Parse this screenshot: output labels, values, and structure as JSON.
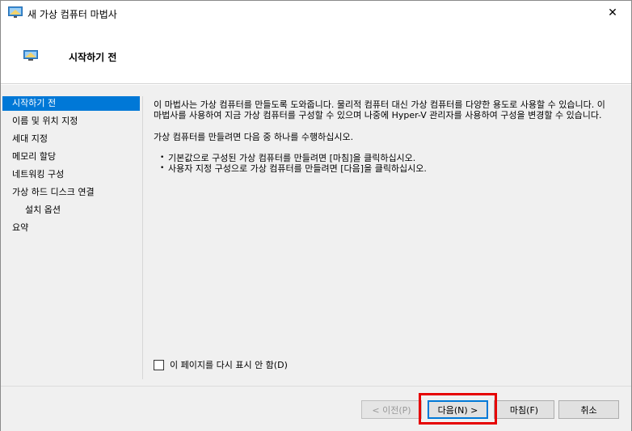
{
  "window": {
    "title": "새 가상 컴퓨터 마법사",
    "close_glyph": "✕",
    "icon": "vm-monitor-icon"
  },
  "header": {
    "title": "시작하기 전"
  },
  "sidebar": {
    "items": [
      {
        "label": "시작하기 전",
        "active": true
      },
      {
        "label": "이름 및 위치 지정",
        "active": false
      },
      {
        "label": "세대 지정",
        "active": false
      },
      {
        "label": "메모리 할당",
        "active": false
      },
      {
        "label": "네트워킹 구성",
        "active": false
      },
      {
        "label": "가상 하드 디스크 연결",
        "active": false
      },
      {
        "label": "설치 옵션",
        "active": false,
        "sub": true
      },
      {
        "label": "요약",
        "active": false
      }
    ]
  },
  "main": {
    "intro": "이 마법사는 가상 컴퓨터를 만들도록 도와줍니다. 물리적 컴퓨터 대신 가상 컴퓨터를 다양한 용도로 사용할 수 있습니다. 이 마법사를 사용하여 지금 가상 컴퓨터를 구성할 수 있으며 나중에 Hyper-V 관리자를 사용하여 구성을 변경할 수 있습니다.",
    "instruction": "가상 컴퓨터를 만들려면 다음 중 하나를 수행하십시오.",
    "bullets": [
      "기본값으로 구성된 가상 컴퓨터를 만들려면 [마침]을 클릭하십시오.",
      "사용자 지정 구성으로 가상 컴퓨터를 만들려면 [다음]을 클릭하십시오."
    ],
    "bullet_glyph": "•",
    "dont_show_label": "이 페이지를 다시 표시 안 함(D)",
    "dont_show_checked": false
  },
  "footer": {
    "prev_label": "< 이전(P)",
    "next_label": "다음(N) >",
    "finish_label": "마침(F)",
    "cancel_label": "취소"
  },
  "colors": {
    "accent": "#0078d7",
    "highlight": "#e60000",
    "panel": "#f0f0f0"
  }
}
